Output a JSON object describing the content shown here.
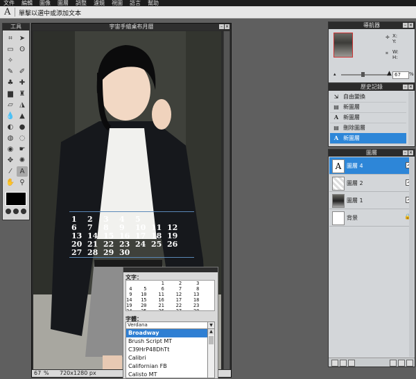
{
  "menubar": [
    "文件",
    "編輯",
    "圖像",
    "圖層",
    "調整",
    "濾鏡",
    "視圖",
    "語言",
    "幫助"
  ],
  "options": {
    "tool_glyph": "A",
    "hint": "單擊以選中或添加文本"
  },
  "toolbox": {
    "title": "工具",
    "tools": [
      "crop-icon",
      "move-icon",
      "marquee-icon",
      "lasso-icon",
      "wand-icon",
      "",
      "pencil-icon",
      "brush-icon",
      "clone-icon",
      "heal-icon",
      "gradient-icon",
      "stamp-icon",
      "eraser-icon",
      "bucket-icon",
      "drop-icon",
      "sharpen-icon",
      "dodge-icon",
      "burn-icon",
      "sponge-icon",
      "blur-icon",
      "redeye-icon",
      "smudge-icon",
      "pinch-icon",
      "bloat-icon",
      "picker-icon",
      "text-icon",
      "hand-icon",
      "zoom-icon"
    ],
    "active_tool": "text-icon",
    "foreground_color": "#000000"
  },
  "canvas": {
    "title": "宇宙手繪桌布月曆",
    "zoom": "67",
    "zoom_unit": "%",
    "dimensions": "720x1280 px",
    "calendar_numbers": [
      {
        "t": "1",
        "c": 0,
        "r": -1
      },
      {
        "t": "2",
        "c": 1,
        "r": -1
      },
      {
        "t": "3",
        "c": 2,
        "r": -1
      },
      {
        "t": "4",
        "c": 3,
        "r": -1
      },
      {
        "t": "5",
        "c": 4,
        "r": -1
      },
      {
        "t": "6",
        "c": 0,
        "r": 0
      },
      {
        "t": "7",
        "c": 1,
        "r": 0
      },
      {
        "t": "8",
        "c": 2,
        "r": 0
      },
      {
        "t": "9",
        "c": 3,
        "r": 0
      },
      {
        "t": "10",
        "c": 4,
        "r": 0
      },
      {
        "t": "11",
        "c": 5,
        "r": 0
      },
      {
        "t": "12",
        "c": 6,
        "r": 0
      },
      {
        "t": "13",
        "c": 0,
        "r": 1
      },
      {
        "t": "14",
        "c": 1,
        "r": 1
      },
      {
        "t": "15",
        "c": 2,
        "r": 1
      },
      {
        "t": "16",
        "c": 3,
        "r": 1
      },
      {
        "t": "17",
        "c": 4,
        "r": 1
      },
      {
        "t": "18",
        "c": 5,
        "r": 1
      },
      {
        "t": "19",
        "c": 6,
        "r": 1
      },
      {
        "t": "20",
        "c": 0,
        "r": 2
      },
      {
        "t": "21",
        "c": 1,
        "r": 2
      },
      {
        "t": "22",
        "c": 2,
        "r": 2
      },
      {
        "t": "23",
        "c": 3,
        "r": 2
      },
      {
        "t": "24",
        "c": 4,
        "r": 2
      },
      {
        "t": "25",
        "c": 5,
        "r": 2
      },
      {
        "t": "26",
        "c": 6,
        "r": 2
      },
      {
        "t": "27",
        "c": 0,
        "r": 3
      },
      {
        "t": "28",
        "c": 1,
        "r": 3
      },
      {
        "t": "29",
        "c": 2,
        "r": 3
      },
      {
        "t": "30",
        "c": 3,
        "r": 3
      }
    ]
  },
  "text_dialog": {
    "text_label": "文字：",
    "text_value": "            1     2     3\n 4    5     6     7     8\n 9   10    11    12    13\n14   15    16    17    18\n19   20    21    22    23\n24   25    26    27    28\n29   30",
    "font_label": "字體：",
    "font_selected": "Verdana",
    "font_options": [
      "Broadway",
      "Brush Script MT",
      "C39HrP48DhTt",
      "Calibri",
      "Californian FB",
      "Calisto MT"
    ],
    "font_highlighted": "Broadway"
  },
  "navigator": {
    "title": "導航器",
    "x_label": "X:",
    "y_label": "Y:",
    "w_label": "W:",
    "h_label": "H:",
    "zoom_value": "67",
    "zoom_unit": "%",
    "zoom_level": 0.45
  },
  "history": {
    "title": "歷史記錄",
    "items": [
      {
        "icon": "transform-icon",
        "glyph": "⇲",
        "label": "自由變換"
      },
      {
        "icon": "new-layer-icon",
        "glyph": "▤",
        "label": "新圖層"
      },
      {
        "icon": "text-layer-icon",
        "glyph": "A",
        "label": "新圖層"
      },
      {
        "icon": "delete-layer-icon",
        "glyph": "▤",
        "label": "刪除圖層"
      },
      {
        "icon": "text-layer-icon",
        "glyph": "A",
        "label": "新圖層"
      }
    ],
    "selected_index": 4
  },
  "layers": {
    "title": "圖層",
    "items": [
      {
        "label": "圖層 4",
        "thumb": "A",
        "type": "text",
        "visible": "✓"
      },
      {
        "label": "圖層 2",
        "thumb": "",
        "type": "transparent",
        "visible": "✓"
      },
      {
        "label": "圖層 1",
        "thumb": "",
        "type": "photo",
        "visible": "✓"
      },
      {
        "label": "背景",
        "thumb": "",
        "type": "background",
        "visible": "🔒"
      }
    ],
    "selected_index": 0
  }
}
